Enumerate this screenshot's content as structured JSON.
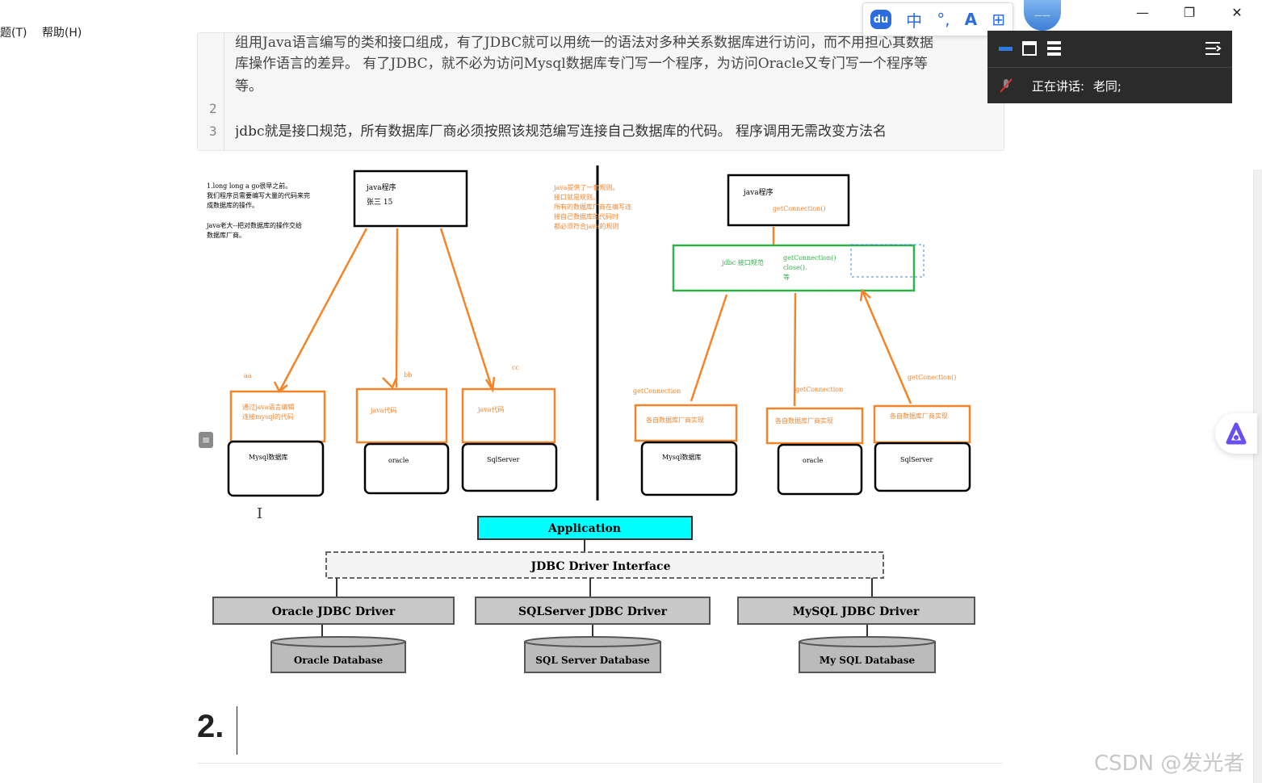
{
  "menubar": {
    "items": [
      "题(T)",
      "帮助(H)"
    ]
  },
  "code_block": {
    "line1_partial": "组用Java语言编写的类和接口组成，有了JDBC就可以用统一的语法对多种关系数据库进行访问，而不用担心其数据",
    "line1_cont": "库操作语言的差异。 有了JDBC，就不必为访问Mysql数据库专门写一个程序，为访问Oracle又专门写一个程序等",
    "line1_end": "等。",
    "line_numbers": [
      "2",
      "3"
    ],
    "line3": "jdbc就是接口规范，所有数据库厂商必须按照该规范编写连接自己数据库的代码。 程序调用无需改变方法名"
  },
  "ime_toolbar": {
    "logo": "du",
    "lang": "中",
    "punct": "°,",
    "items": [
      "A",
      "⊞"
    ]
  },
  "window_controls": {
    "minimize": "—",
    "restore": "❐",
    "close": "✕"
  },
  "meeting": {
    "speaking_label": "正在讲话:",
    "speaker": "老同;"
  },
  "diagram_left": {
    "note": [
      "1.long long a go很早之前。",
      "我们程序员需要编写大量的代码来完",
      "成数据库的操作。",
      "",
      "java老大--把对数据库的操作交给",
      "数据库厂商。"
    ],
    "java_box": [
      "java程序",
      "张三   15"
    ],
    "labels": [
      "aa",
      "bb",
      "cc"
    ],
    "impl_boxes": [
      "通过java语言编辑\n连接mysql的代码",
      "java代码",
      "java代码"
    ],
    "db_boxes": [
      "Mysql数据库",
      "oracle",
      "SqlServer"
    ]
  },
  "diagram_right": {
    "note": [
      "java提供了一套规则。",
      "接口就是规则。",
      "所有的数据库厂商在编写连",
      "接自己数据库的代码时",
      "都必须符合java的规则"
    ],
    "java_box": [
      "java程序",
      "getConnection()"
    ],
    "jdbc_box": {
      "label": "jdbc 接口规范",
      "methods": [
        "getConnection()",
        "close().",
        "等"
      ]
    },
    "labels": [
      "getConnection",
      "getConnection",
      "getConection()"
    ],
    "impl_boxes": [
      "各自数据库厂商实现",
      "各自数据库厂商实现",
      "各自数据库厂商实现"
    ],
    "db_boxes": [
      "Mysql数据库",
      "oracle",
      "SqlServer"
    ]
  },
  "arch": {
    "application": "Application",
    "interface": "JDBC Driver Interface",
    "drivers": [
      "Oracle JDBC Driver",
      "SQLServer JDBC Driver",
      "MySQL JDBC Driver"
    ],
    "databases": [
      "Oracle Database",
      "SQL Server Database",
      "My SQL Database"
    ]
  },
  "heading": "2.",
  "watermark": "CSDN @发光者",
  "colors": {
    "orange": "#f58428",
    "green": "#2fb24a",
    "cyan": "#00ffff",
    "dark": "#2b2b2b"
  }
}
